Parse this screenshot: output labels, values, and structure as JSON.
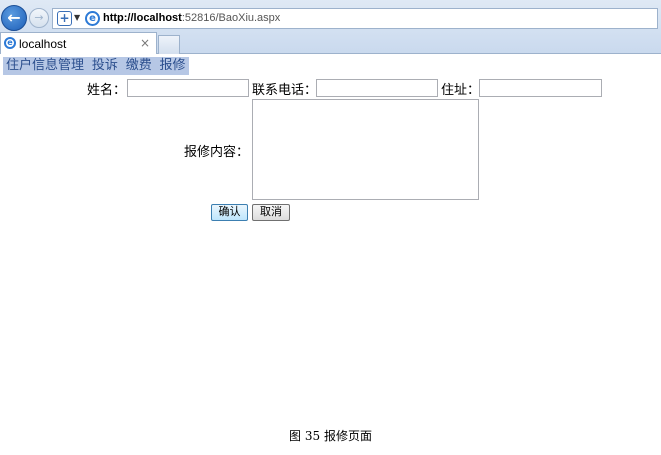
{
  "browser": {
    "url_host": "http://localhost",
    "url_rest": ":52816/BaoXiu.aspx",
    "tab_title": "localhost",
    "tab_close": "×",
    "icons": {
      "back": "back-arrow-icon",
      "forward": "forward-arrow-icon",
      "site": "ie-icon",
      "compat": "plus-icon"
    }
  },
  "menu": {
    "items": [
      "住户信息管理",
      "投诉",
      "缴费",
      "报修"
    ]
  },
  "form": {
    "name_label": "姓名：",
    "phone_label": "联系电话：",
    "address_label": "住址：",
    "content_label": "报修内容：",
    "name_value": "",
    "phone_value": "",
    "address_value": "",
    "content_value": "",
    "confirm_label": "确认",
    "cancel_label": "取消"
  },
  "caption": "图 35 报修页面"
}
